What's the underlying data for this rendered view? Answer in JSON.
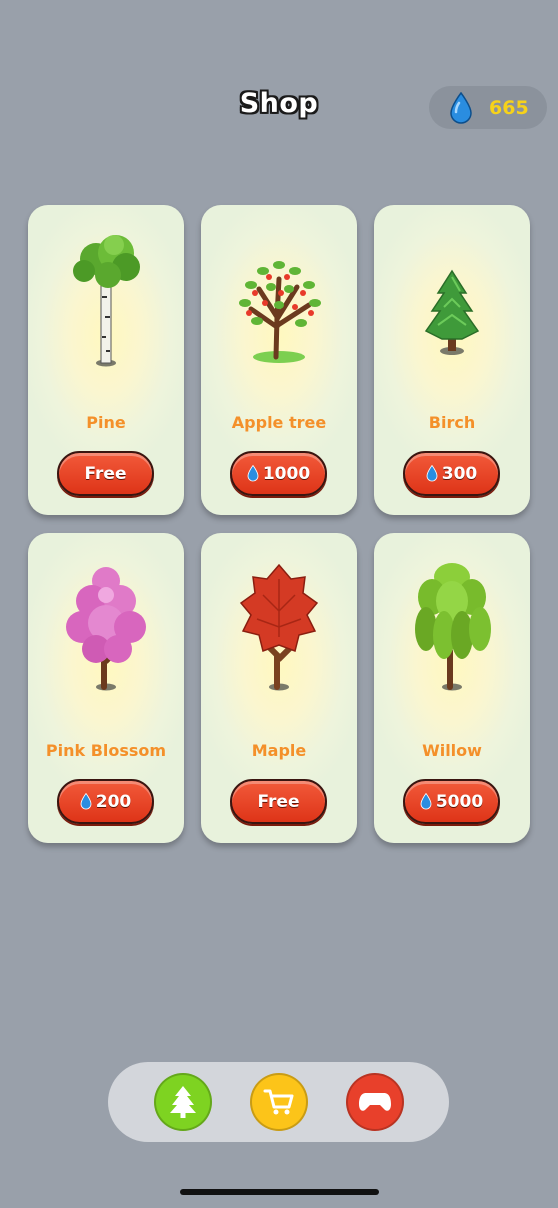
{
  "header": {
    "title": "Shop"
  },
  "currency": {
    "amount": "665",
    "icon": "water-drop-icon",
    "color": "#f6d21a"
  },
  "items": [
    {
      "name": "Pine",
      "price": "Free",
      "has_drop": false,
      "icon": "birch-tree-icon"
    },
    {
      "name": "Apple tree",
      "price": "1000",
      "has_drop": true,
      "icon": "apple-tree-icon"
    },
    {
      "name": "Birch",
      "price": "300",
      "has_drop": true,
      "icon": "pine-tree-icon"
    },
    {
      "name": "Pink Blossom",
      "price": "200",
      "has_drop": true,
      "icon": "pink-blossom-tree-icon"
    },
    {
      "name": "Maple",
      "price": "Free",
      "has_drop": false,
      "icon": "maple-tree-icon"
    },
    {
      "name": "Willow",
      "price": "5000",
      "has_drop": true,
      "icon": "willow-tree-icon"
    }
  ],
  "nav": [
    {
      "icon": "tree-icon",
      "color": "#7ed321"
    },
    {
      "icon": "shopping-cart-icon",
      "color": "#fcc419"
    },
    {
      "icon": "gamepad-icon",
      "color": "#e8402b"
    }
  ]
}
